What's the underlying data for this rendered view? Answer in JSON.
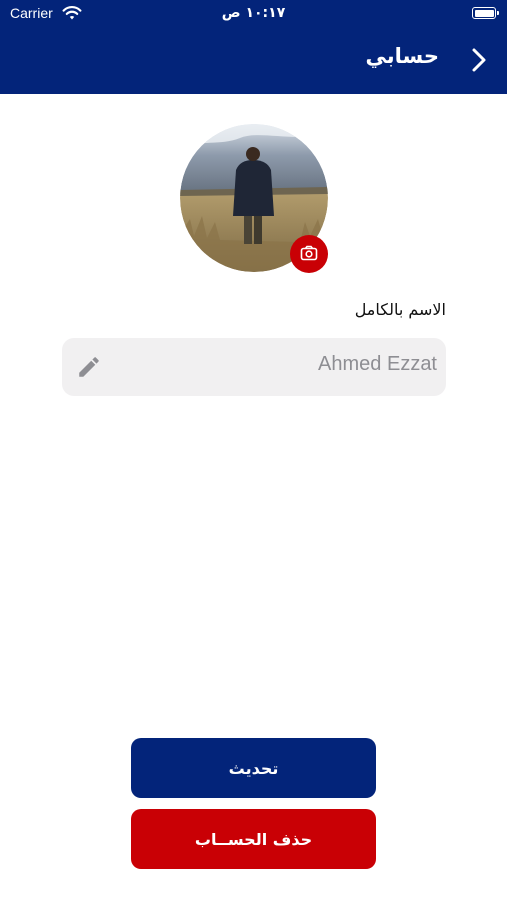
{
  "status_bar": {
    "carrier": "Carrier",
    "time": "١٠:١٧ ص"
  },
  "header": {
    "title": "حسابي",
    "back_icon": "chevron-right-icon",
    "background": "#03247a"
  },
  "profile": {
    "camera_icon": "camera-icon",
    "badge_color": "#c90005"
  },
  "form": {
    "full_name_label": "الاسم بالكامل",
    "full_name_value": "Ahmed Ezzat",
    "edit_icon": "pencil-icon"
  },
  "actions": {
    "update_label": "تحديث",
    "delete_label": "حذف الحســاب",
    "update_color": "#03247a",
    "delete_color": "#c90005"
  }
}
